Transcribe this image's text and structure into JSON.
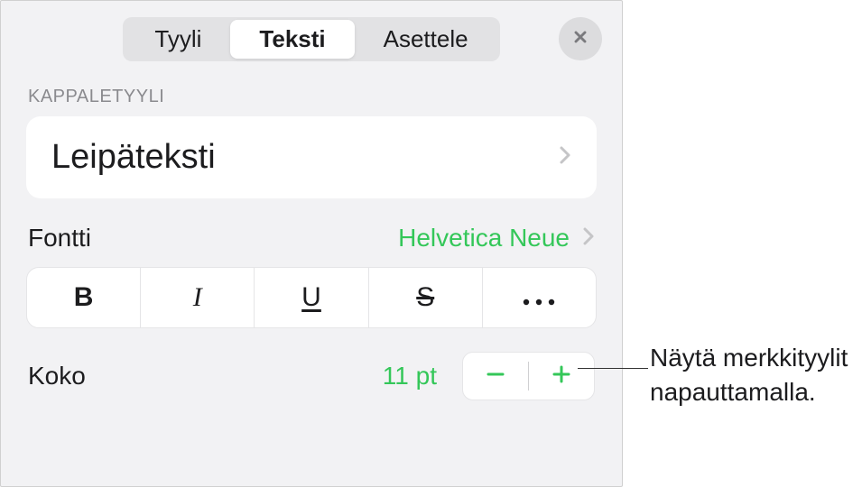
{
  "tabs": {
    "style": "Tyyli",
    "text": "Teksti",
    "arrange": "Asettele"
  },
  "section": {
    "paragraph_style_label": "KAPPALETYYLI",
    "paragraph_style_value": "Leipäteksti"
  },
  "font": {
    "label": "Fontti",
    "value": "Helvetica Neue"
  },
  "size": {
    "label": "Koko",
    "value": "11 pt"
  },
  "callout": {
    "line1": "Näytä merkkityylit",
    "line2": "napauttamalla."
  }
}
